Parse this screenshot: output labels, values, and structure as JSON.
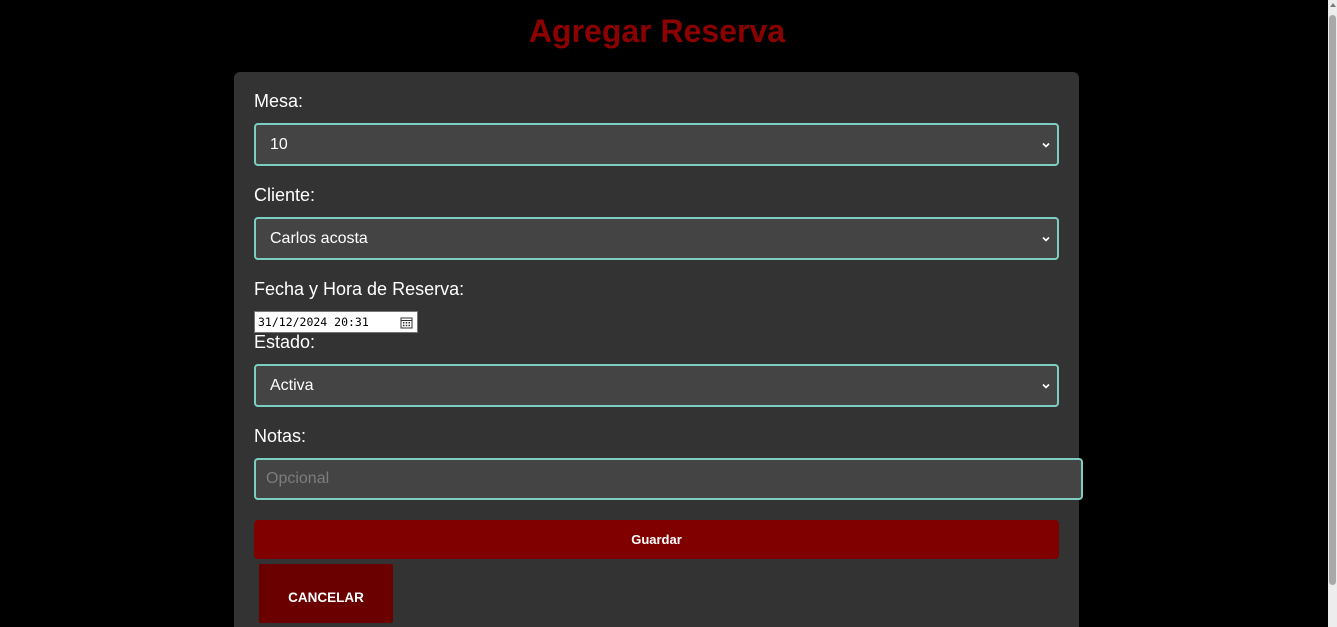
{
  "page": {
    "title": "Agregar Reserva"
  },
  "form": {
    "mesa": {
      "label": "Mesa:",
      "value": "10",
      "icon": "chevron-down-icon"
    },
    "cliente": {
      "label": "Cliente:",
      "value": "Carlos acosta",
      "icon": "chevron-down-icon"
    },
    "fecha": {
      "label": "Fecha y Hora de Reserva:",
      "value": "31/12/2024 20:31",
      "icon": "calendar-icon"
    },
    "estado": {
      "label": "Estado:",
      "value": "Activa",
      "icon": "chevron-down-icon"
    },
    "notas": {
      "label": "Notas:",
      "placeholder": "Opcional",
      "value": ""
    }
  },
  "actions": {
    "save_label": "Guardar",
    "cancel_label": "CANCELAR"
  },
  "colors": {
    "background": "#000000",
    "card": "#333333",
    "title": "#8b0000",
    "field_border": "#7ccfc0",
    "field_bg": "#444444",
    "save_button": "#800000",
    "cancel_button": "#6b0000"
  }
}
